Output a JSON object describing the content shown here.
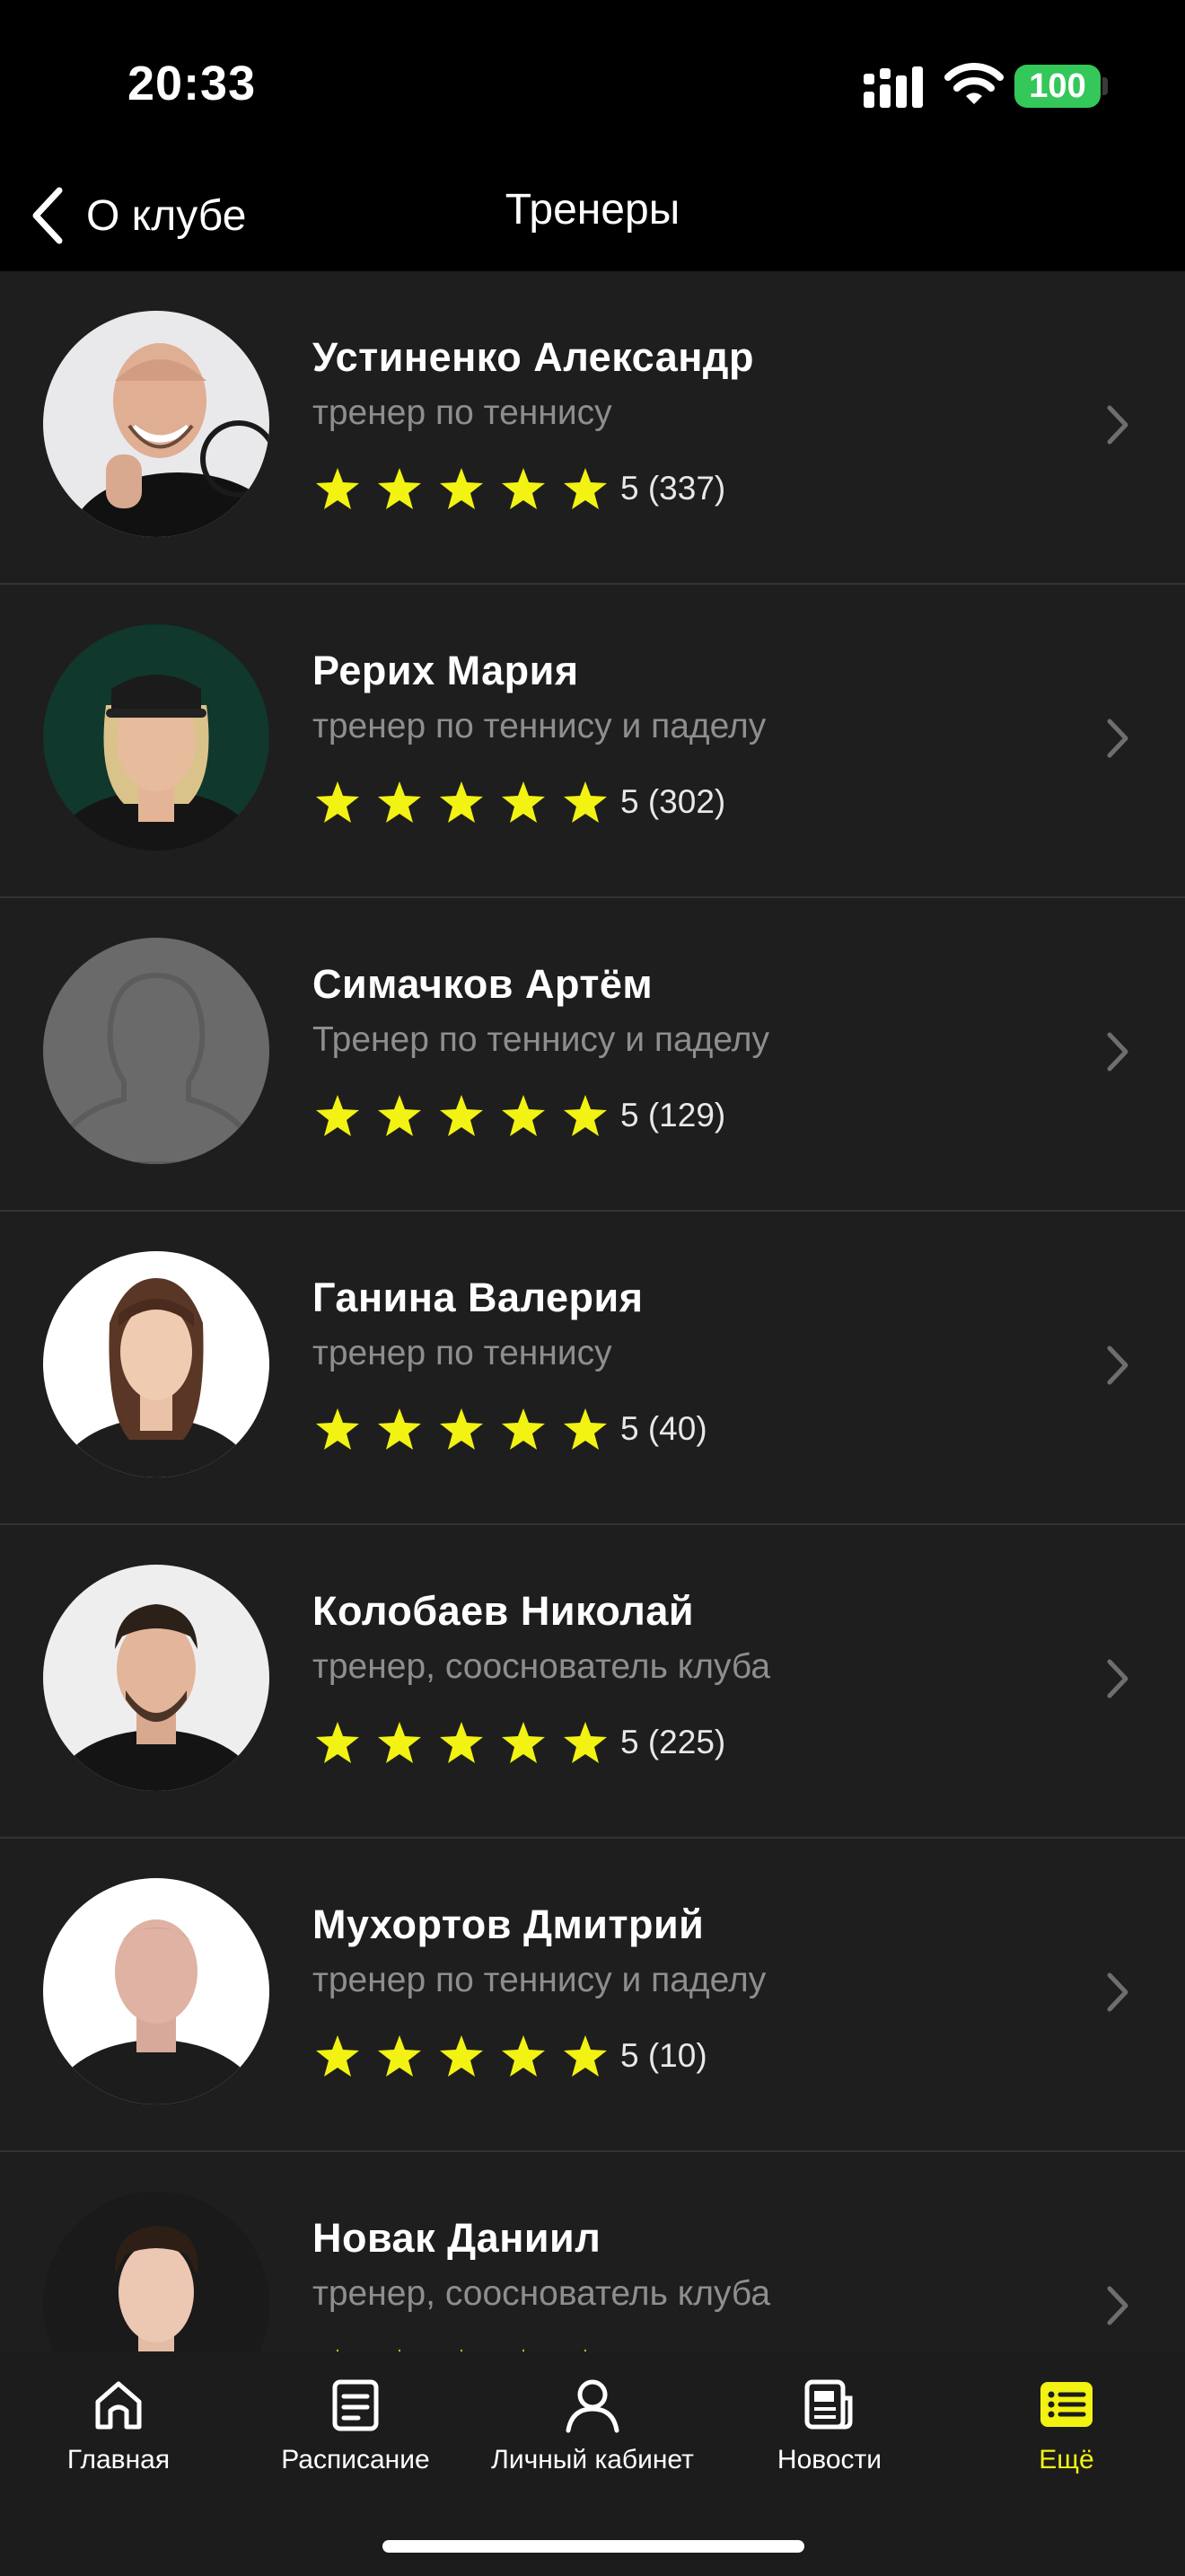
{
  "status_bar": {
    "time": "20:33",
    "battery": "100"
  },
  "nav": {
    "back_label": "О клубе",
    "title": "Тренеры"
  },
  "colors": {
    "accent": "#f2f213",
    "background": "#1e1e1e",
    "secondary_text": "#8e8e8e",
    "battery": "#34c759"
  },
  "trainers": [
    {
      "name": "Устиненко Александр",
      "role": "тренер по теннису",
      "rating": 5,
      "reviews": "5 (337)"
    },
    {
      "name": "Рерих Мария",
      "role": "тренер по теннису и паделу",
      "rating": 5,
      "reviews": "5 (302)"
    },
    {
      "name": "Симачков Артём",
      "role": "Тренер по теннису и паделу",
      "rating": 5,
      "reviews": "5 (129)"
    },
    {
      "name": "Ганина Валерия",
      "role": "тренер по теннису",
      "rating": 5,
      "reviews": "5 (40)"
    },
    {
      "name": "Колобаев Николай",
      "role": "тренер, сооснователь клуба",
      "rating": 5,
      "reviews": "5 (225)"
    },
    {
      "name": "Мухортов Дмитрий",
      "role": "тренер по теннису и паделу",
      "rating": 5,
      "reviews": "5 (10)"
    },
    {
      "name": "Новак Даниил",
      "role": "тренер, сооснователь клуба",
      "rating": 5,
      "reviews": ""
    }
  ],
  "tabs": [
    {
      "label": "Главная",
      "icon": "home-icon"
    },
    {
      "label": "Расписание",
      "icon": "schedule-icon"
    },
    {
      "label": "Личный кабинет",
      "icon": "profile-icon"
    },
    {
      "label": "Новости",
      "icon": "news-icon"
    },
    {
      "label": "Ещё",
      "icon": "more-icon",
      "active": true
    }
  ]
}
